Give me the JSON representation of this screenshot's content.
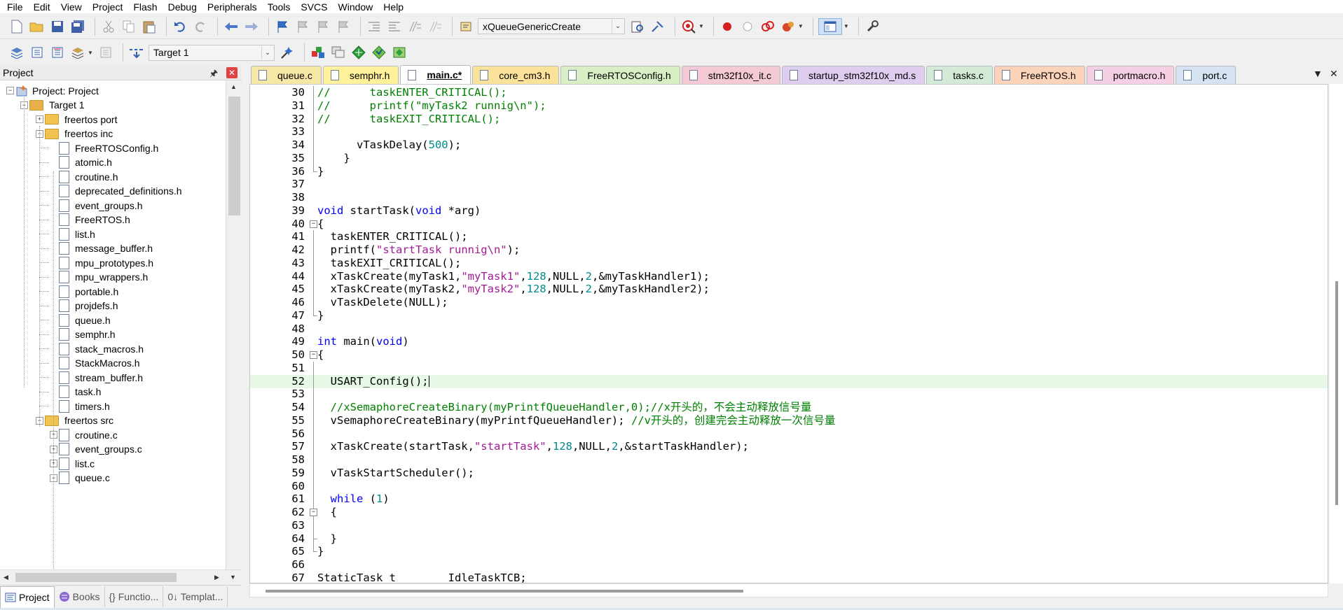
{
  "menu": [
    "File",
    "Edit",
    "View",
    "Project",
    "Flash",
    "Debug",
    "Peripherals",
    "Tools",
    "SVCS",
    "Window",
    "Help"
  ],
  "toolbar": {
    "function_combo": "xQueueGenericCreate",
    "target_combo": "Target 1"
  },
  "project_panel": {
    "title": "Project",
    "tree": [
      {
        "label": "Project: Project",
        "type": "root",
        "level": 0,
        "expander": "−"
      },
      {
        "label": "Target 1",
        "type": "target",
        "level": 1,
        "expander": "−"
      },
      {
        "label": "freertos port",
        "type": "folder",
        "level": 2,
        "expander": "+"
      },
      {
        "label": "freertos inc",
        "type": "folder",
        "level": 2,
        "expander": "−"
      },
      {
        "label": "FreeRTOSConfig.h",
        "type": "file",
        "level": 3
      },
      {
        "label": "atomic.h",
        "type": "file",
        "level": 3
      },
      {
        "label": "croutine.h",
        "type": "file",
        "level": 3
      },
      {
        "label": "deprecated_definitions.h",
        "type": "file",
        "level": 3
      },
      {
        "label": "event_groups.h",
        "type": "file",
        "level": 3
      },
      {
        "label": "FreeRTOS.h",
        "type": "file",
        "level": 3
      },
      {
        "label": "list.h",
        "type": "file",
        "level": 3
      },
      {
        "label": "message_buffer.h",
        "type": "file",
        "level": 3
      },
      {
        "label": "mpu_prototypes.h",
        "type": "file",
        "level": 3
      },
      {
        "label": "mpu_wrappers.h",
        "type": "file",
        "level": 3
      },
      {
        "label": "portable.h",
        "type": "file",
        "level": 3
      },
      {
        "label": "projdefs.h",
        "type": "file",
        "level": 3
      },
      {
        "label": "queue.h",
        "type": "file",
        "level": 3
      },
      {
        "label": "semphr.h",
        "type": "file",
        "level": 3
      },
      {
        "label": "stack_macros.h",
        "type": "file",
        "level": 3
      },
      {
        "label": "StackMacros.h",
        "type": "file",
        "level": 3
      },
      {
        "label": "stream_buffer.h",
        "type": "file",
        "level": 3
      },
      {
        "label": "task.h",
        "type": "file",
        "level": 3
      },
      {
        "label": "timers.h",
        "type": "file",
        "level": 3
      },
      {
        "label": "freertos src",
        "type": "folder",
        "level": 2,
        "expander": "−"
      },
      {
        "label": "croutine.c",
        "type": "file",
        "level": 3,
        "expander": "+"
      },
      {
        "label": "event_groups.c",
        "type": "file",
        "level": 3,
        "expander": "+"
      },
      {
        "label": "list.c",
        "type": "file",
        "level": 3,
        "expander": "+"
      },
      {
        "label": "queue.c",
        "type": "file",
        "level": 3,
        "expander": "−"
      }
    ],
    "bottom_tabs": [
      "Project",
      "Books",
      "{} Functio...",
      "0↓ Templat..."
    ]
  },
  "editor": {
    "tabs": [
      {
        "label": "queue.c",
        "color": "#f7e7a6"
      },
      {
        "label": "semphr.h",
        "color": "#fff29a"
      },
      {
        "label": "main.c*",
        "color": "#ffffff",
        "active": true
      },
      {
        "label": "core_cm3.h",
        "color": "#fbe29a"
      },
      {
        "label": "FreeRTOSConfig.h",
        "color": "#d8efc6"
      },
      {
        "label": "stm32f10x_it.c",
        "color": "#f5c9d3"
      },
      {
        "label": "startup_stm32f10x_md.s",
        "color": "#dfcdf0"
      },
      {
        "label": "tasks.c",
        "color": "#d3ead7"
      },
      {
        "label": "FreeRTOS.h",
        "color": "#fad3b8"
      },
      {
        "label": "portmacro.h",
        "color": "#f5cfe3"
      },
      {
        "label": "port.c",
        "color": "#d5e3f3"
      }
    ],
    "lines": [
      {
        "n": "30",
        "html": "<span class=\"cm\">//      taskENTER_CRITICAL();</span>"
      },
      {
        "n": "31",
        "html": "<span class=\"cm\">//      printf(\"myTask2 runnig\\n\");</span>"
      },
      {
        "n": "32",
        "html": "<span class=\"cm\">//      taskEXIT_CRITICAL();</span>"
      },
      {
        "n": "33",
        "html": ""
      },
      {
        "n": "34",
        "html": "      vTaskDelay(<span class=\"num\">500</span>);"
      },
      {
        "n": "35",
        "html": "    }"
      },
      {
        "n": "36",
        "html": "}"
      },
      {
        "n": "37",
        "html": ""
      },
      {
        "n": "38",
        "html": ""
      },
      {
        "n": "39",
        "html": "<span class=\"kw\">void</span> startTask(<span class=\"kw\">void</span> *arg)"
      },
      {
        "n": "40",
        "html": "{"
      },
      {
        "n": "41",
        "html": "  taskENTER_CRITICAL();"
      },
      {
        "n": "42",
        "html": "  printf(<span class=\"str\">\"startTask runnig\\n\"</span>);"
      },
      {
        "n": "43",
        "html": "  taskEXIT_CRITICAL();"
      },
      {
        "n": "44",
        "html": "  xTaskCreate(myTask1,<span class=\"str\">\"myTask1\"</span>,<span class=\"num\">128</span>,NULL,<span class=\"num\">2</span>,&amp;myTaskHandler1);"
      },
      {
        "n": "45",
        "html": "  xTaskCreate(myTask2,<span class=\"str\">\"myTask2\"</span>,<span class=\"num\">128</span>,NULL,<span class=\"num\">2</span>,&amp;myTaskHandler2);"
      },
      {
        "n": "46",
        "html": "  vTaskDelete(NULL);"
      },
      {
        "n": "47",
        "html": "}"
      },
      {
        "n": "48",
        "html": ""
      },
      {
        "n": "49",
        "html": "<span class=\"kw\">int</span> main(<span class=\"kw\">void</span>)"
      },
      {
        "n": "50",
        "html": "{"
      },
      {
        "n": "51",
        "html": ""
      },
      {
        "n": "52",
        "html": "  USART_Config();<span class=\"caret\"></span>"
      },
      {
        "n": "53",
        "html": ""
      },
      {
        "n": "54",
        "html": "  <span class=\"cm\">//xSemaphoreCreateBinary(myPrintfQueueHandler,0);//x开头的，不会主动释放信号量</span>"
      },
      {
        "n": "55",
        "html": "  vSemaphoreCreateBinary(myPrintfQueueHandler); <span class=\"cm\">//v开头的，创建完会主动释放一次信号量</span>"
      },
      {
        "n": "56",
        "html": ""
      },
      {
        "n": "57",
        "html": "  xTaskCreate(startTask,<span class=\"str\">\"startTask\"</span>,<span class=\"num\">128</span>,NULL,<span class=\"num\">2</span>,&amp;startTaskHandler);"
      },
      {
        "n": "58",
        "html": ""
      },
      {
        "n": "59",
        "html": "  vTaskStartScheduler();"
      },
      {
        "n": "60",
        "html": ""
      },
      {
        "n": "61",
        "html": "  <span class=\"kw\">while</span> (<span class=\"num\">1</span>)"
      },
      {
        "n": "62",
        "html": "  {"
      },
      {
        "n": "63",
        "html": ""
      },
      {
        "n": "64",
        "html": "  }"
      },
      {
        "n": "65",
        "html": "}"
      },
      {
        "n": "66",
        "html": ""
      },
      {
        "n": "67",
        "html": "StaticTask_t        IdleTaskTCB;"
      }
    ],
    "current_line": "52"
  }
}
